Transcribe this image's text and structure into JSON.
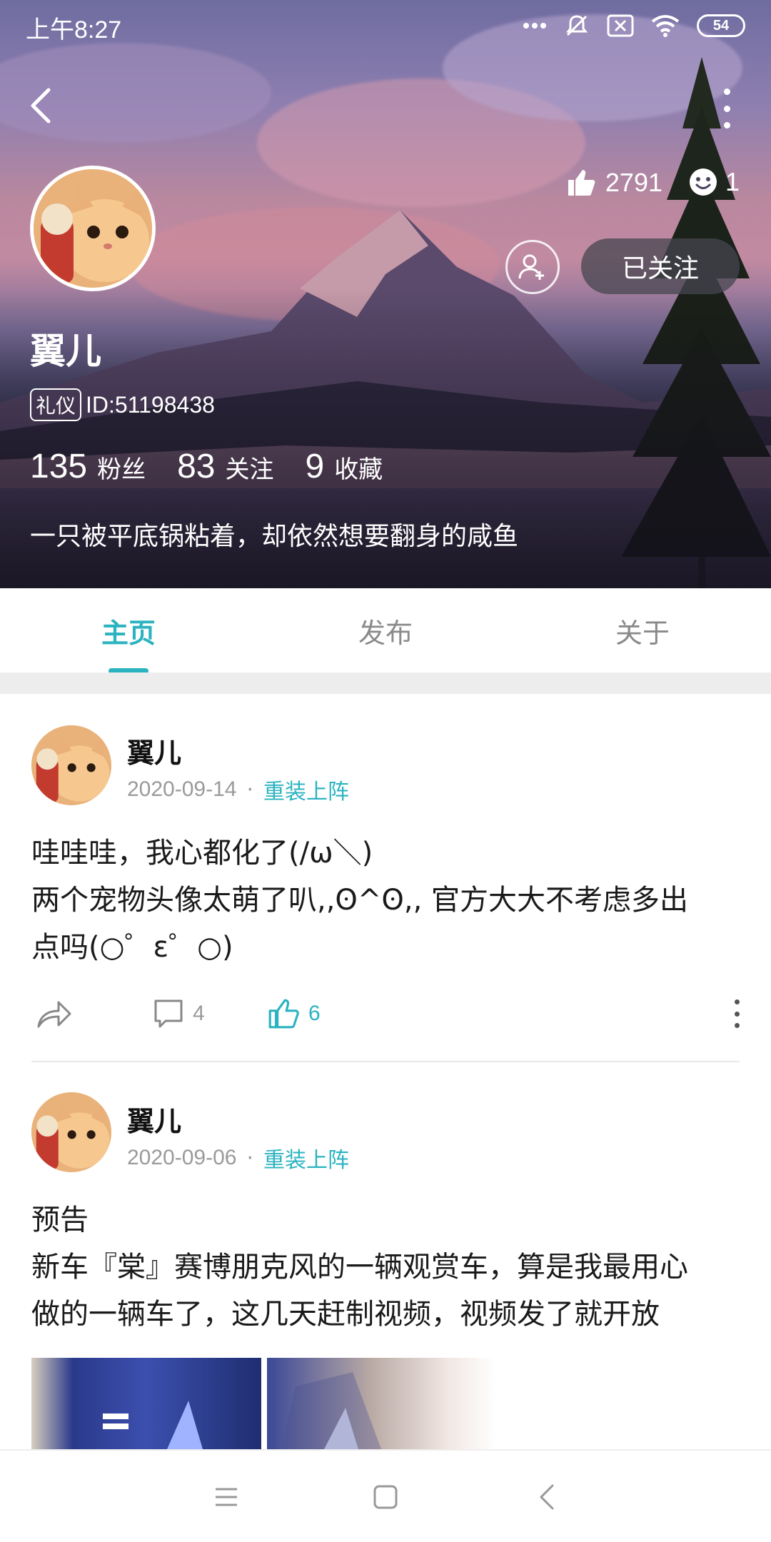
{
  "status_bar": {
    "time": "上午8:27",
    "battery": "54"
  },
  "profile": {
    "likes_count": "2791",
    "fans_count": "1",
    "follow_button": "已关注",
    "username": "翼儿",
    "badge": "礼仪",
    "user_id": "ID:51198438",
    "stats": [
      {
        "num": "135",
        "label": "粉丝"
      },
      {
        "num": "83",
        "label": "关注"
      },
      {
        "num": "9",
        "label": "收藏"
      }
    ],
    "bio": "一只被平底锅粘着，却依然想要翻身的咸鱼"
  },
  "tabs": [
    "主页",
    "发布",
    "关于"
  ],
  "posts": [
    {
      "author": "翼儿",
      "date": "2020-09-14",
      "tag": "重装上阵",
      "lines": [
        "哇哇哇，我心都化了(/ω＼)",
        "两个宠物头像太萌了叭,,ʘ^ʘ,, 官方大大不考虑多出",
        "点吗(○゜ε゜○)"
      ],
      "comments": "4",
      "likes": "6"
    },
    {
      "author": "翼儿",
      "date": "2020-09-06",
      "tag": "重装上阵",
      "lines": [
        "预告",
        "新车『棠』赛博朋克风的一辆观赏车，算是我最用心",
        "做的一辆车了，这几天赶制视频，视频发了就开放"
      ]
    }
  ],
  "colors": {
    "accent": "#2bb3c0"
  }
}
